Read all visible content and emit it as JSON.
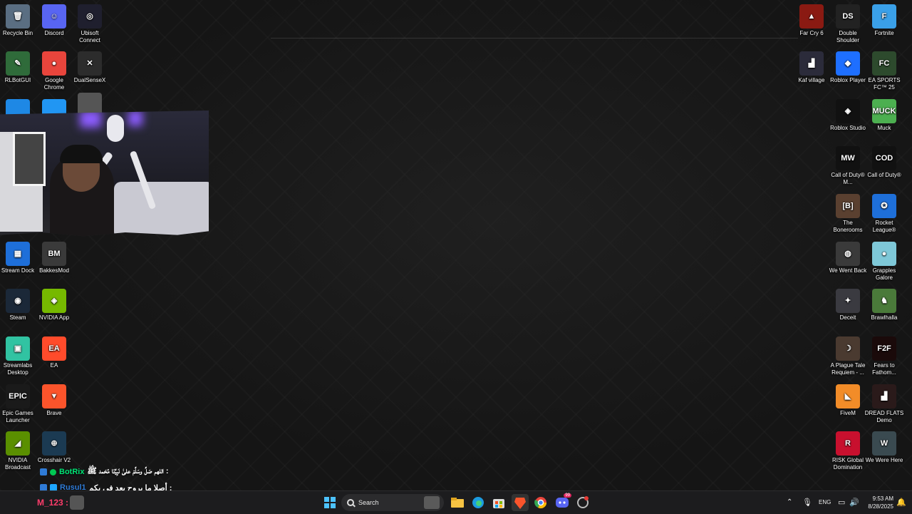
{
  "desktop_left": [
    {
      "label": "Recycle Bin",
      "icon": "recycle-bin-icon",
      "color": "#5a6e82",
      "glyph": "🗑"
    },
    {
      "label": "Discord",
      "icon": "discord-icon",
      "color": "#5865f2",
      "glyph": "☺"
    },
    {
      "label": "Ubisoft Connect",
      "icon": "ubisoft-icon",
      "color": "#1f1f2e",
      "glyph": "◎"
    },
    {
      "label": "RLBotGUI",
      "icon": "rlbot-icon",
      "color": "#2f6b3a",
      "glyph": "✎"
    },
    {
      "label": "Google Chrome",
      "icon": "chrome-icon",
      "color": "#e8453c",
      "glyph": "●"
    },
    {
      "label": "DualSenseX",
      "icon": "dualsensex-icon",
      "color": "#2c2c2c",
      "glyph": "✕"
    },
    {
      "label": "Stream Dock",
      "icon": "stream-dock-icon",
      "color": "#1e6fd9",
      "glyph": "▦"
    },
    {
      "label": "BakkesMod",
      "icon": "bakkesmod-icon",
      "color": "#3a3a3a",
      "glyph": "BM"
    },
    {
      "label": "Steam",
      "icon": "steam-icon",
      "color": "#1b2838",
      "glyph": "◉"
    },
    {
      "label": "NVIDIA App",
      "icon": "nvidia-icon",
      "color": "#76b900",
      "glyph": "◈"
    },
    {
      "label": "Streamlabs Desktop",
      "icon": "streamlabs-icon",
      "color": "#31c3a2",
      "glyph": "▣"
    },
    {
      "label": "EA",
      "icon": "ea-icon",
      "color": "#ff4b2b",
      "glyph": "EA"
    },
    {
      "label": "Epic Games Launcher",
      "icon": "epic-games-icon",
      "color": "#1a1a1a",
      "glyph": "EPIC"
    },
    {
      "label": "Brave",
      "icon": "brave-icon",
      "color": "#fb542b",
      "glyph": "▼"
    },
    {
      "label": "NVIDIA Broadcast",
      "icon": "nvidia-broadcast-icon",
      "color": "#5a8f00",
      "glyph": "◢"
    },
    {
      "label": "Crosshair V2",
      "icon": "crosshair-icon",
      "color": "#1b3a52",
      "glyph": "⊕"
    }
  ],
  "desktop_right": [
    {
      "label": "Far Cry 6",
      "icon": "far-cry-6-icon",
      "color": "#8a1a12",
      "glyph": "▲"
    },
    {
      "label": "Double Shoulder",
      "icon": "double-shoulder-icon",
      "color": "#222",
      "glyph": "DS"
    },
    {
      "label": "Fortnite",
      "icon": "fortnite-icon",
      "color": "#3aa0e8",
      "glyph": "F"
    },
    {
      "label": "Kaf village",
      "icon": "kaf-village-icon",
      "color": "#2b2b3a",
      "glyph": "▟"
    },
    {
      "label": "Roblox Player",
      "icon": "roblox-player-icon",
      "color": "#1e6fff",
      "glyph": "◆"
    },
    {
      "label": "EA SPORTS FC™ 25",
      "icon": "ea-fc25-icon",
      "color": "#2d4a2d",
      "glyph": "FC"
    },
    {
      "label": "Roblox Studio",
      "icon": "roblox-studio-icon",
      "color": "#111",
      "glyph": "◈"
    },
    {
      "label": "Muck",
      "icon": "muck-icon",
      "color": "#4caf50",
      "glyph": "MUCK"
    },
    {
      "label": "Call of Duty® M...",
      "icon": "cod-mw3-icon",
      "color": "#111",
      "glyph": "MW"
    },
    {
      "label": "Call of Duty®",
      "icon": "call-of-duty-icon",
      "color": "#111",
      "glyph": "COD"
    },
    {
      "label": "The Bonerooms",
      "icon": "bonerooms-icon",
      "color": "#5a4030",
      "glyph": "[B]"
    },
    {
      "label": "Rocket League®",
      "icon": "rocket-league-icon",
      "color": "#1e6fd9",
      "glyph": "✪"
    },
    {
      "label": "We Went Back",
      "icon": "we-went-back-icon",
      "color": "#3a3a3a",
      "glyph": "◍"
    },
    {
      "label": "Grapples Galore",
      "icon": "grapples-galore-icon",
      "color": "#7ec8d8",
      "glyph": "●"
    },
    {
      "label": "Deceit",
      "icon": "deceit-icon",
      "color": "#3a3a40",
      "glyph": "✦"
    },
    {
      "label": "Brawlhalla",
      "icon": "brawlhalla-icon",
      "color": "#4a7a3a",
      "glyph": "♞"
    },
    {
      "label": "A Plague Tale Requiem - ...",
      "icon": "plague-tale-icon",
      "color": "#4a3a30",
      "glyph": "☽"
    },
    {
      "label": "Fears to Fathom...",
      "icon": "fears-to-fathom-icon",
      "color": "#1a0a0a",
      "glyph": "F2F"
    },
    {
      "label": "FiveM",
      "icon": "fivem-icon",
      "color": "#f28c28",
      "glyph": "◣"
    },
    {
      "label": "DREAD FLATS Demo",
      "icon": "dread-flats-icon",
      "color": "#2a1a1a",
      "glyph": "▟"
    },
    {
      "label": "RISK Global Domination",
      "icon": "risk-icon",
      "color": "#c8102e",
      "glyph": "R"
    },
    {
      "label": "We Were Here",
      "icon": "we-were-here-icon",
      "color": "#3a4a50",
      "glyph": "W"
    }
  ],
  "chat": {
    "line1_user": "BotRix",
    "line1_msg": "اللهم صَلِّ وسَلِّمْ علىٰ نَبِيِّنَا مُحَمد ﷺ :",
    "line2_user": "Rusul1",
    "line2_msg": "أصلا ما بروح بعد في بكم :",
    "line3_user": "M_123 :"
  },
  "taskbar": {
    "search_placeholder": "Search",
    "language": "ENG",
    "time": "9:53 AM",
    "date": "8/28/2025",
    "discord_badge": "99"
  }
}
